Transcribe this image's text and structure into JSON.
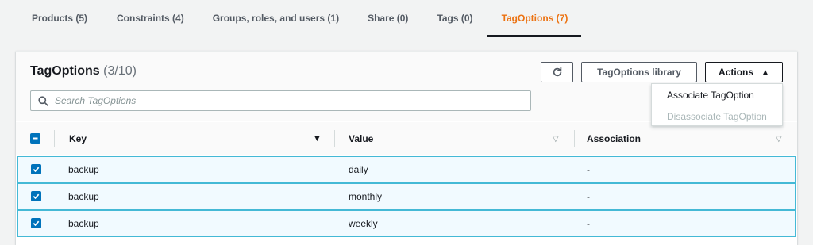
{
  "tabs": [
    {
      "label": "Products (5)",
      "active": false
    },
    {
      "label": "Constraints (4)",
      "active": false
    },
    {
      "label": "Groups, roles, and users (1)",
      "active": false
    },
    {
      "label": "Share (0)",
      "active": false
    },
    {
      "label": "Tags (0)",
      "active": false
    },
    {
      "label": "TagOptions (7)",
      "active": true
    }
  ],
  "panel": {
    "title": "TagOptions",
    "count": "(3/10)"
  },
  "search": {
    "placeholder": "Search TagOptions"
  },
  "buttons": {
    "refresh_icon": "refresh-icon",
    "library": "TagOptions library",
    "actions": "Actions",
    "actions_caret": "▲"
  },
  "actions_menu": [
    {
      "label": "Associate TagOption",
      "disabled": false
    },
    {
      "label": "Disassociate TagOption",
      "disabled": true
    }
  ],
  "table": {
    "columns": [
      "Key",
      "Value",
      "Association"
    ],
    "rows": [
      {
        "key": "backup",
        "value": "daily",
        "association": "-",
        "selected": true
      },
      {
        "key": "backup",
        "value": "monthly",
        "association": "-",
        "selected": true
      },
      {
        "key": "backup",
        "value": "weekly",
        "association": "-",
        "selected": true
      }
    ]
  },
  "colors": {
    "accent": "#ec7211",
    "selection": "#0073bb",
    "row_highlight": "#f1faff",
    "row_border": "#44b9d6"
  }
}
